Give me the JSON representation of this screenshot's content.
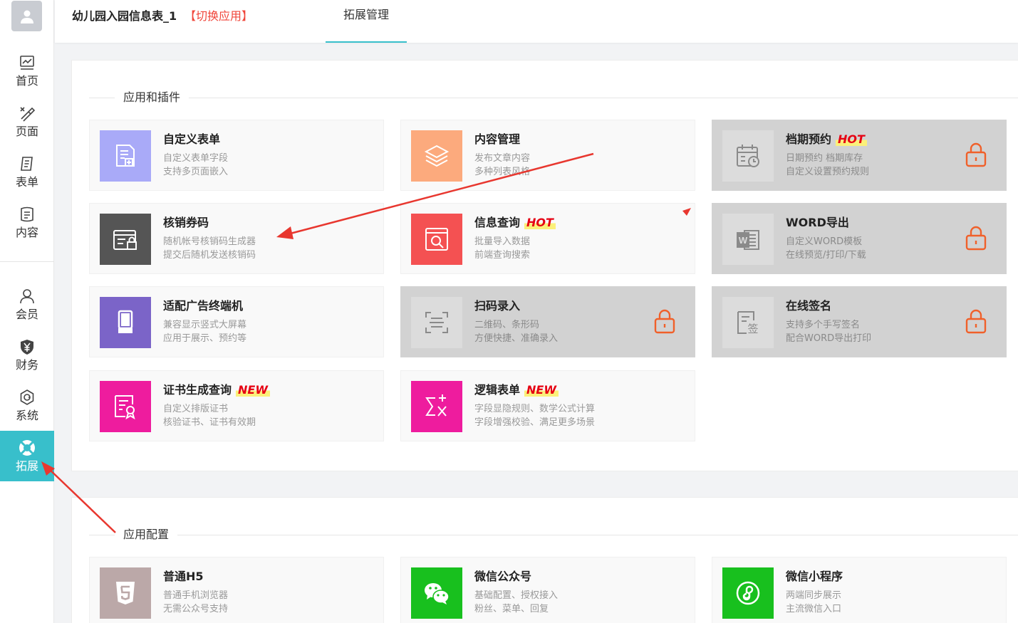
{
  "colors": {
    "accent": "#38bfcb",
    "lock": "#f0602a",
    "badge": "#e60012",
    "arrow": "#e8372f"
  },
  "sidebar": {
    "items": [
      {
        "label": "首页",
        "icon": "chart-icon"
      },
      {
        "label": "页面",
        "icon": "brush-icon"
      },
      {
        "label": "表单",
        "icon": "form-icon"
      },
      {
        "label": "内容",
        "icon": "content-icon"
      },
      {
        "label": "会员",
        "icon": "user-icon"
      },
      {
        "label": "财务",
        "icon": "yen-shield-icon"
      },
      {
        "label": "系统",
        "icon": "gear-icon"
      },
      {
        "label": "拓展",
        "icon": "lifebuoy-icon",
        "active": true
      }
    ]
  },
  "header": {
    "app_title": "幼儿园入园信息表_1",
    "switch_label": "【切换应用】",
    "tab_label": "拓展管理"
  },
  "section1": {
    "title": "应用和插件",
    "cards": [
      {
        "title": "自定义表单",
        "badge": "",
        "desc1": "自定义表单字段",
        "desc2": "支持多页面嵌入",
        "color": "#a9aaf8",
        "icon": "custom-form-icon",
        "locked": false
      },
      {
        "title": "内容管理",
        "badge": "",
        "desc1": "发布文章内容",
        "desc2": "多种列表风格",
        "color": "#fcaa7d",
        "icon": "layers-icon",
        "locked": false
      },
      {
        "title": "档期预约",
        "badge": "HOT",
        "desc1": "日期预约 档期库存",
        "desc2": "自定义设置预约规则",
        "color": "",
        "icon": "calendar-clock-icon",
        "locked": true
      },
      {
        "title": "核销券码",
        "badge": "",
        "desc1": "随机帐号核销码生成器",
        "desc2": "提交后随机发送核销码",
        "color": "#555555",
        "icon": "coupon-lock-icon",
        "locked": false
      },
      {
        "title": "信息查询",
        "badge": "HOT",
        "desc1": "批量导入数据",
        "desc2": "前端查询搜索",
        "color": "#f45152",
        "icon": "doc-search-icon",
        "locked": false
      },
      {
        "title": "WORD导出",
        "badge": "",
        "desc1": "自定义WORD模板",
        "desc2": "在线预览/打印/下载",
        "color": "",
        "icon": "word-icon",
        "locked": true
      },
      {
        "title": "适配广告终端机",
        "badge": "",
        "desc1": "兼容显示竖式大屏幕",
        "desc2": "应用于展示、预约等",
        "color": "#7b64c8",
        "icon": "kiosk-icon",
        "locked": false
      },
      {
        "title": "扫码录入",
        "badge": "",
        "desc1": "二维码、条形码",
        "desc2": "方便快捷、准确录入",
        "color": "",
        "icon": "scan-icon",
        "locked": true
      },
      {
        "title": "在线签名",
        "badge": "",
        "desc1": "支持多个手写签名",
        "desc2": "配合WORD导出打印",
        "color": "",
        "icon": "signature-icon",
        "locked": true
      },
      {
        "title": "证书生成查询",
        "badge": "NEW",
        "desc1": "自定义排版证书",
        "desc2": "核验证书、证书有效期",
        "color": "#ee1c9e",
        "icon": "certificate-icon",
        "locked": false
      },
      {
        "title": "逻辑表单",
        "badge": "NEW",
        "desc1": "字段显隐规则、数学公式计算",
        "desc2": "字段增强校验、满足更多场景",
        "color": "#ee1c9e",
        "icon": "formula-icon",
        "locked": false
      }
    ]
  },
  "section2": {
    "title": "应用配置",
    "cards": [
      {
        "title": "普通H5",
        "badge": "",
        "desc1": "普通手机浏览器",
        "desc2": "无需公众号支持",
        "color": "#bba8a8",
        "icon": "html5-icon",
        "locked": false
      },
      {
        "title": "微信公众号",
        "badge": "",
        "desc1": "基础配置、授权接入",
        "desc2": "粉丝、菜单、回复",
        "color": "#18c01e",
        "icon": "wechat-icon",
        "locked": false
      },
      {
        "title": "微信小程序",
        "badge": "",
        "desc1": "两端同步展示",
        "desc2": "主流微信入口",
        "color": "#18c01e",
        "icon": "miniprogram-icon",
        "locked": false
      }
    ]
  }
}
